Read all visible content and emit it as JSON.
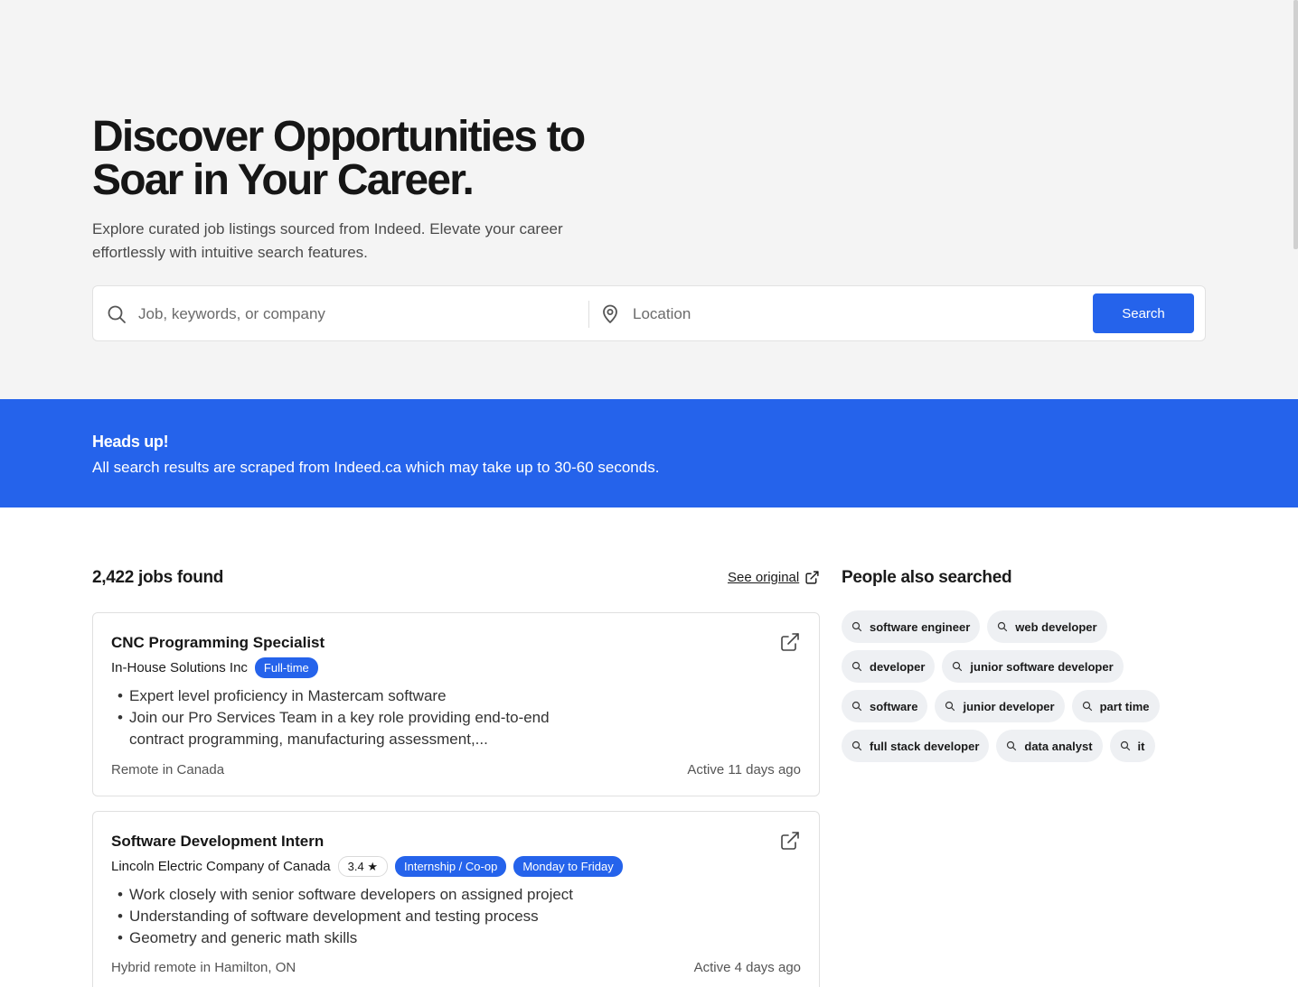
{
  "hero": {
    "title": "Discover Opportunities to Soar in Your Career.",
    "subtitle": "Explore curated job listings sourced from Indeed. Elevate your career effortlessly with intuitive search features."
  },
  "search": {
    "keyword_placeholder": "Job, keywords, or company",
    "location_placeholder": "Location",
    "button_label": "Search"
  },
  "banner": {
    "title": "Heads up!",
    "text": "All search results are scraped from Indeed.ca which may take up to 30-60 seconds."
  },
  "results": {
    "count_label": "2,422 jobs found",
    "see_original_label": "See original"
  },
  "jobs": [
    {
      "title": "CNC Programming Specialist",
      "company": "In-House Solutions Inc",
      "badges": [
        "Full-time"
      ],
      "bullets": [
        "Expert level proficiency in Mastercam software",
        "Join our Pro Services Team in a key role providing end-to-end contract programming, manufacturing assessment,..."
      ],
      "location": "Remote in Canada",
      "active": "Active 11 days ago"
    },
    {
      "title": "Software Development Intern",
      "company": "Lincoln Electric Company of Canada",
      "rating": "3.4 ★",
      "badges": [
        "Internship / Co-op",
        "Monday to Friday"
      ],
      "bullets": [
        "Work closely with senior software developers on assigned project",
        "Understanding of software development and testing process",
        "Geometry and generic math skills"
      ],
      "location": "Hybrid remote in Hamilton, ON",
      "active": "Active 4 days ago"
    }
  ],
  "people_also_searched": {
    "title": "People also searched",
    "items": [
      "software engineer",
      "web developer",
      "developer",
      "junior software developer",
      "software",
      "junior developer",
      "part time",
      "full stack developer",
      "data analyst",
      "it"
    ]
  },
  "colors": {
    "accent": "#2563eb",
    "hero_bg": "#f4f4f4",
    "chip_bg": "#eef0f3"
  }
}
